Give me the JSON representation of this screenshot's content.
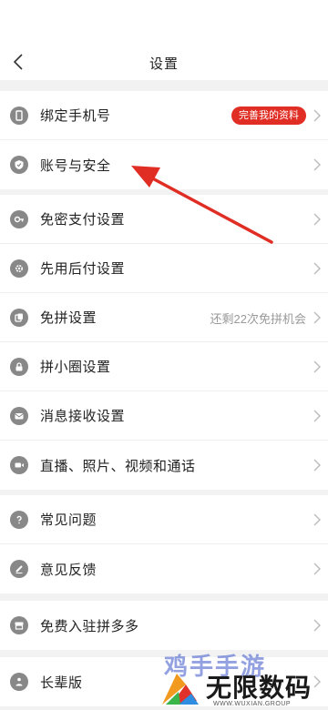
{
  "header": {
    "title": "设置",
    "back_icon": "chevron-left-icon"
  },
  "groups": [
    {
      "items": [
        {
          "label": "绑定手机号",
          "icon": "phone-icon",
          "badge": "完善我的资料"
        },
        {
          "label": "账号与安全",
          "icon": "shield-icon"
        }
      ]
    },
    {
      "items": [
        {
          "label": "免密支付设置",
          "icon": "key-icon"
        },
        {
          "label": "先用后付设置",
          "icon": "gear-icon"
        },
        {
          "label": "免拼设置",
          "icon": "copy-icon",
          "right_text": "还剩22次免拼机会"
        },
        {
          "label": "拼小圈设置",
          "icon": "lock-icon"
        },
        {
          "label": "消息接收设置",
          "icon": "mail-icon"
        },
        {
          "label": "直播、照片、视频和通话",
          "icon": "video-icon"
        }
      ]
    },
    {
      "items": [
        {
          "label": "常见问题",
          "icon": "question-icon"
        },
        {
          "label": "意见反馈",
          "icon": "pencil-icon"
        }
      ]
    },
    {
      "items": [
        {
          "label": "免费入驻拼多多",
          "icon": "store-icon"
        }
      ]
    },
    {
      "items": [
        {
          "label": "长辈版",
          "icon": "elder-icon"
        }
      ]
    }
  ],
  "watermark": {
    "top_text": "鸡手手游",
    "main_text": "无限数码",
    "sub_text": "WWW.WUXIAN.GROUP"
  },
  "colors": {
    "badge_bg": "#e02e24",
    "icon_gray": "#888888",
    "annotation_arrow": "#e02e24"
  }
}
